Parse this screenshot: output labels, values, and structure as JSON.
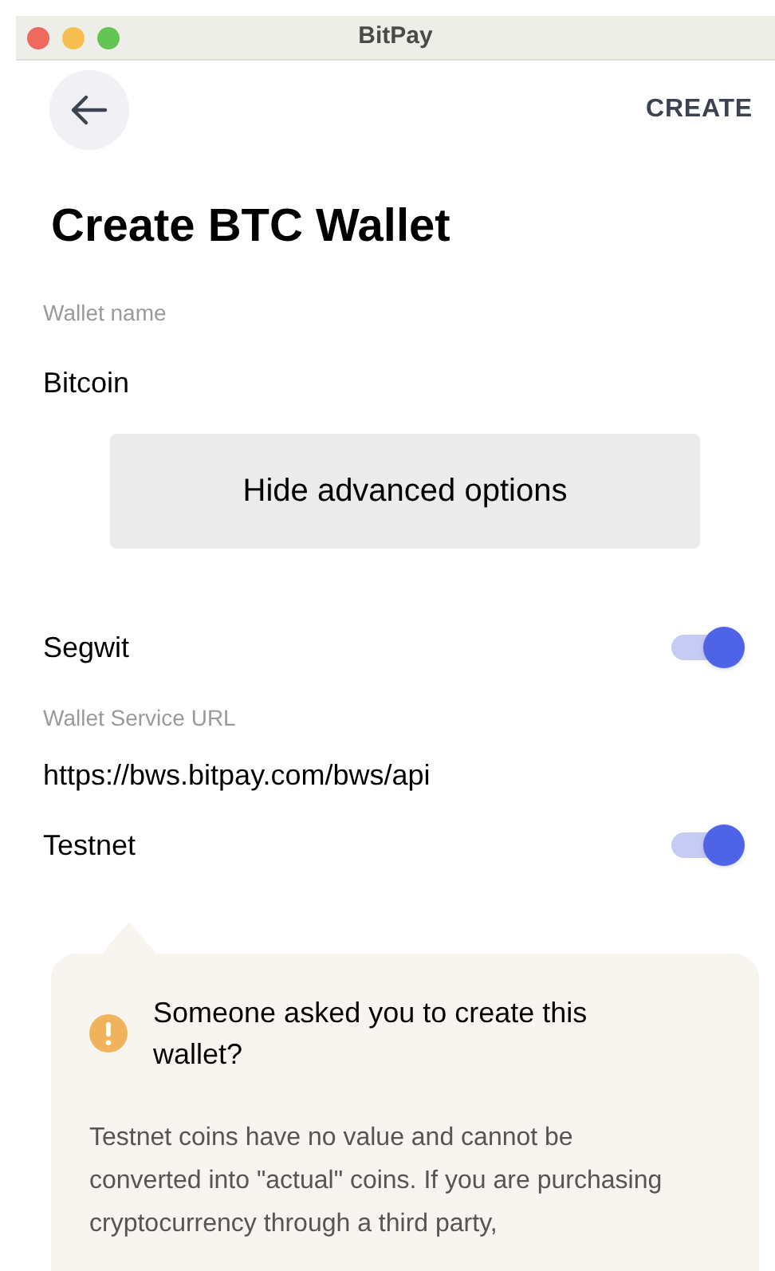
{
  "window": {
    "title": "BitPay"
  },
  "header": {
    "create_label": "CREATE"
  },
  "title": "Create BTC Wallet",
  "wallet_name": {
    "label": "Wallet name",
    "value": "Bitcoin"
  },
  "advanced_button": "Hide advanced options",
  "settings": [
    {
      "kind": "toggle",
      "label": "Segwit",
      "on": true
    },
    {
      "kind": "field",
      "label": "Wallet Service URL",
      "value": "https://bws.bitpay.com/bws/api"
    },
    {
      "kind": "toggle",
      "label": "Testnet",
      "on": true
    }
  ],
  "warning": {
    "heading": "Someone asked you to create this wallet?",
    "body": "Testnet coins have no value and cannot be converted into \"actual\" coins. If you are purchasing cryptocurrency through a third party,"
  }
}
